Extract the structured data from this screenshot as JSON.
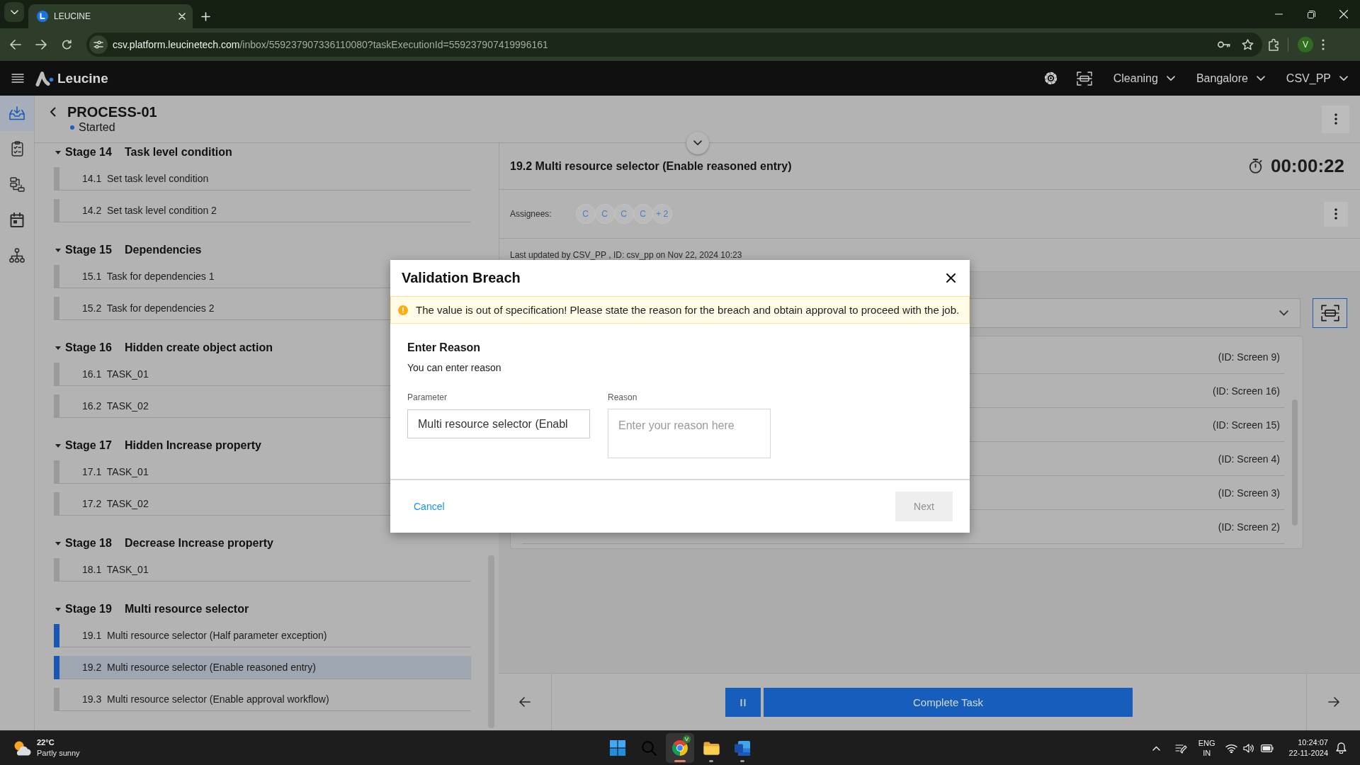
{
  "browser": {
    "tab_title": "LEUCINE",
    "url_host": "csv.platform.leucinetech.com",
    "url_path": "/inbox/559237907336110080?taskExecutionId=559237907419996161",
    "profile_initial": "V"
  },
  "app_header": {
    "brand": "Leucine",
    "menus": [
      {
        "label": "Cleaning"
      },
      {
        "label": "Bangalore"
      },
      {
        "label": "CSV_PP"
      }
    ]
  },
  "nav_rail": [
    {
      "kind": "inbox",
      "selected": true
    },
    {
      "kind": "checklist",
      "selected": false
    },
    {
      "kind": "flow",
      "selected": false
    },
    {
      "kind": "calendar",
      "selected": false
    },
    {
      "kind": "hierarchy",
      "selected": false
    }
  ],
  "process": {
    "title": "PROCESS-01",
    "status": "Started"
  },
  "stages": [
    {
      "number": "Stage 14",
      "title": "Task level condition",
      "expanded": true,
      "tasks": [
        {
          "number": "14.1",
          "title": "Set task level condition",
          "color": "#9a9a9a",
          "selected": false
        },
        {
          "number": "14.2",
          "title": "Set task level condition 2",
          "color": "#9a9a9a",
          "selected": false
        }
      ]
    },
    {
      "number": "Stage 15",
      "title": "Dependencies",
      "expanded": true,
      "tasks": [
        {
          "number": "15.1",
          "title": "Task for dependencies 1",
          "color": "#9a9a9a",
          "selected": false
        },
        {
          "number": "15.2",
          "title": "Task for dependencies 2",
          "color": "#9a9a9a",
          "selected": false
        }
      ]
    },
    {
      "number": "Stage 16",
      "title": "Hidden create object action",
      "expanded": true,
      "tasks": [
        {
          "number": "16.1",
          "title": "TASK_01",
          "color": "#9a9a9a",
          "selected": false
        },
        {
          "number": "16.2",
          "title": "TASK_02",
          "color": "#9a9a9a",
          "selected": false
        }
      ]
    },
    {
      "number": "Stage 17",
      "title": "Hidden Increase property",
      "expanded": true,
      "tasks": [
        {
          "number": "17.1",
          "title": "TASK_01",
          "color": "#9a9a9a",
          "selected": false
        },
        {
          "number": "17.2",
          "title": "TASK_02",
          "color": "#9a9a9a",
          "selected": false
        }
      ]
    },
    {
      "number": "Stage 18",
      "title": "Decrease Increase property",
      "expanded": true,
      "tasks": [
        {
          "number": "18.1",
          "title": "TASK_01",
          "color": "#9a9a9a",
          "selected": false
        }
      ]
    },
    {
      "number": "Stage 19",
      "title": "Multi resource selector",
      "expanded": true,
      "tasks": [
        {
          "number": "19.1",
          "title": "Multi resource selector (Half parameter exception)",
          "color": "#1a56b4",
          "selected": false
        },
        {
          "number": "19.2",
          "title": "Multi resource selector (Enable reasoned entry)",
          "color": "#1a56b4",
          "selected": true
        },
        {
          "number": "19.3",
          "title": "Multi resource selector (Enable approval workflow)",
          "color": "#9a9a9a",
          "selected": false
        }
      ]
    }
  ],
  "task_panel": {
    "title": "19.2 Multi resource selector (Enable reasoned entry)",
    "timer": "00:00:22",
    "assignees_label": "Assignees:",
    "assignees": [
      "C",
      "C",
      "C",
      "C"
    ],
    "more_assignees": "+ 2",
    "last_updated": "Last updated by CSV_PP , ID: csv_pp on Nov 22, 2024 10:23",
    "resource_ids": [
      "(ID: Screen 9)",
      "(ID: Screen 16)",
      "(ID: Screen 15)",
      "(ID: Screen 4)",
      "(ID: Screen 3)",
      "(ID: Screen 2)"
    ]
  },
  "footer": {
    "complete_button": "Complete Task"
  },
  "modal": {
    "title": "Validation Breach",
    "warning": "The value is out of specification! Please state the reason for the breach and obtain approval to proceed with the job.",
    "heading": "Enter Reason",
    "hint": "You can enter reason",
    "parameter_label": "Parameter",
    "parameter_value": "Multi resource selector (Enabl",
    "reason_label": "Reason",
    "reason_placeholder": "Enter your reason here",
    "cancel": "Cancel",
    "next": {
      "label": "Next",
      "disabled": true
    }
  },
  "taskbar": {
    "temperature": "22°C",
    "weather": "Partly sunny",
    "apps": [
      {
        "kind": "start",
        "selected": false,
        "running": false
      },
      {
        "kind": "search",
        "selected": false,
        "running": false
      },
      {
        "kind": "browser",
        "selected": true,
        "running": true,
        "badge": "V"
      },
      {
        "kind": "folder",
        "selected": false,
        "running": true
      },
      {
        "kind": "word",
        "selected": false,
        "running": true
      }
    ],
    "language": "ENG",
    "region": "IN",
    "time": "10:24:07",
    "date": "22-11-2024"
  }
}
